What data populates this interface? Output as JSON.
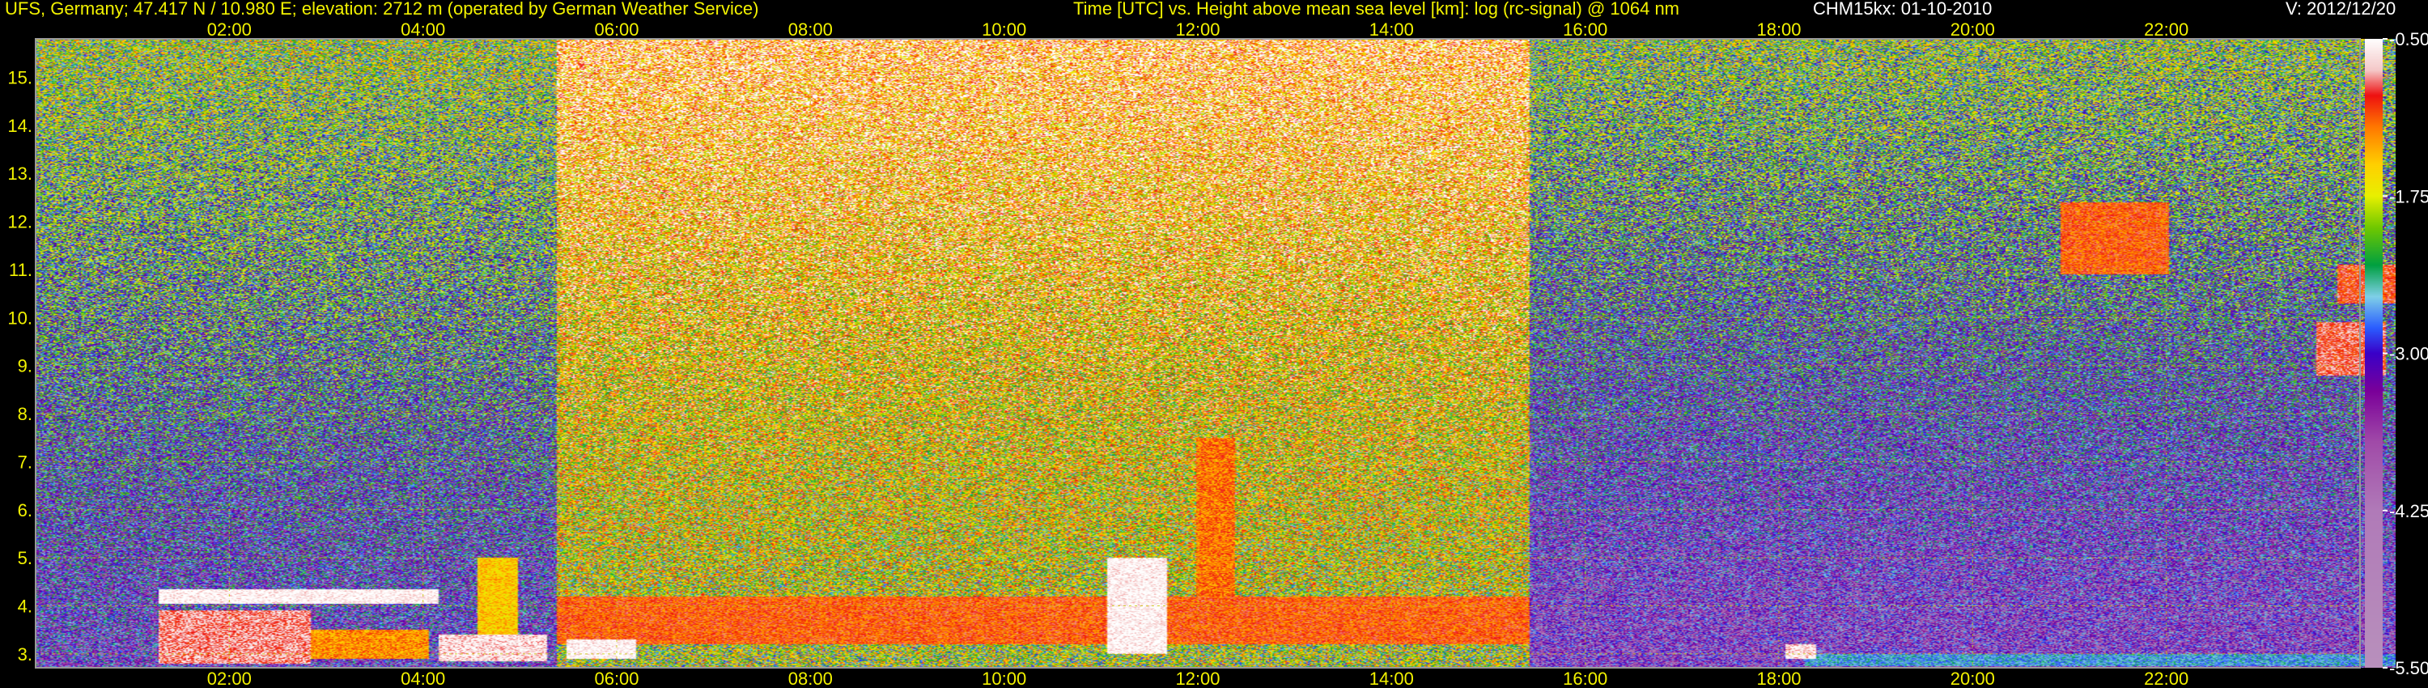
{
  "header": {
    "station": "UFS, Germany; 47.417 N / 10.980 E; elevation: 2712 m  (operated by German Weather Service)",
    "plot_title": "Time [UTC] vs. Height above mean sea level [km]: log (rc-signal) @ 1064 nm",
    "instrument_date": "CHM15kx: 01-10-2010",
    "version": "V: 2012/12/20"
  },
  "colors": {
    "text_yellow": "#f2f200",
    "text_white": "#ffffff",
    "grid": "#c8c800",
    "background": "#000000"
  },
  "chart_data": {
    "type": "heatmap",
    "title": "Time [UTC] vs. Height above mean sea level [km]: log (rc-signal) @ 1064 nm",
    "xlabel": "Time [UTC]",
    "ylabel": "Height above mean sea level [km]",
    "x_unit": "hours UTC",
    "xlim": [
      0.0,
      24.0
    ],
    "ylim": [
      2.712,
      15.8
    ],
    "x_ticks": [
      2,
      4,
      6,
      8,
      10,
      12,
      14,
      16,
      18,
      20,
      22
    ],
    "x_tick_labels": [
      "02:00",
      "04:00",
      "06:00",
      "08:00",
      "10:00",
      "12:00",
      "14:00",
      "16:00",
      "18:00",
      "20:00",
      "22:00"
    ],
    "y_ticks": [
      3,
      4,
      5,
      6,
      7,
      8,
      9,
      10,
      11,
      12,
      13,
      14,
      15
    ],
    "y_tick_labels": [
      "3.",
      "4.",
      "5.",
      "6.",
      "7.",
      "8.",
      "9.",
      "10.",
      "11.",
      "12.",
      "13.",
      "14.",
      "15."
    ],
    "grid": true,
    "colorbar": {
      "position": "right",
      "range": [
        -5.5,
        -0.5
      ],
      "tick_values": [
        -0.5,
        -1.75,
        -3.0,
        -4.25,
        -5.5
      ],
      "tick_labels": [
        "-0.50",
        "-1.75",
        "-3.00",
        "-4.25",
        "-5.50"
      ],
      "stops": [
        {
          "value": -0.5,
          "color": "#ffffff"
        },
        {
          "value": -0.75,
          "color": "#f4c8c8"
        },
        {
          "value": -0.95,
          "color": "#ee1010"
        },
        {
          "value": -1.2,
          "color": "#ff7800"
        },
        {
          "value": -1.5,
          "color": "#ffd000"
        },
        {
          "value": -1.75,
          "color": "#e8f000"
        },
        {
          "value": -2.0,
          "color": "#70c800"
        },
        {
          "value": -2.3,
          "color": "#00a040"
        },
        {
          "value": -2.55,
          "color": "#7fd0e8"
        },
        {
          "value": -2.8,
          "color": "#2a5cff"
        },
        {
          "value": -3.0,
          "color": "#3a00c8"
        },
        {
          "value": -3.3,
          "color": "#7a0099"
        },
        {
          "value": -3.7,
          "color": "#a04aa8"
        },
        {
          "value": -4.25,
          "color": "#b07ab8"
        },
        {
          "value": -5.5,
          "color": "#b890bc"
        }
      ]
    },
    "regimes": [
      {
        "t_start": 0.0,
        "t_end": 5.3,
        "background_upper": -2.0,
        "background_lower": -3.2
      },
      {
        "t_start": 5.3,
        "t_end": 15.2,
        "background_upper": -0.9,
        "background_lower": -2.0
      },
      {
        "t_start": 15.2,
        "t_end": 24.0,
        "background_upper": -2.1,
        "background_lower": -3.5
      }
    ],
    "features": [
      {
        "t_start": 1.25,
        "t_end": 2.8,
        "z_bottom": 2.8,
        "z_top": 3.9,
        "value": -0.8
      },
      {
        "t_start": 1.25,
        "t_end": 4.1,
        "z_bottom": 4.05,
        "z_top": 4.35,
        "value": -0.5
      },
      {
        "t_start": 2.8,
        "t_end": 4.0,
        "z_bottom": 2.9,
        "z_top": 3.5,
        "value": -1.3
      },
      {
        "t_start": 4.1,
        "t_end": 5.2,
        "z_bottom": 2.85,
        "z_top": 3.4,
        "value": -0.6
      },
      {
        "t_start": 4.5,
        "t_end": 4.9,
        "z_bottom": 3.4,
        "z_top": 5.0,
        "value": -1.5
      },
      {
        "t_start": 5.4,
        "t_end": 6.1,
        "z_bottom": 2.9,
        "z_top": 3.3,
        "value": -0.5
      },
      {
        "t_start": 5.3,
        "t_end": 15.2,
        "z_bottom": 3.2,
        "z_top": 4.2,
        "value": -1.1
      },
      {
        "t_start": 10.9,
        "t_end": 11.5,
        "z_bottom": 3.0,
        "z_top": 5.0,
        "value": -0.5
      },
      {
        "t_start": 11.8,
        "t_end": 12.2,
        "z_bottom": 3.6,
        "z_top": 7.5,
        "value": -1.2
      },
      {
        "t_start": 17.8,
        "t_end": 18.1,
        "z_bottom": 2.9,
        "z_top": 3.2,
        "value": -0.6
      },
      {
        "t_start": 18.0,
        "t_end": 24.0,
        "z_bottom": 2.75,
        "z_top": 3.0,
        "value": -2.6
      },
      {
        "t_start": 20.6,
        "t_end": 21.7,
        "z_bottom": 10.9,
        "z_top": 12.4,
        "value": -1.1
      },
      {
        "t_start": 23.2,
        "t_end": 23.9,
        "z_bottom": 8.8,
        "z_top": 9.9,
        "value": -0.9
      },
      {
        "t_start": 23.4,
        "t_end": 24.0,
        "z_bottom": 10.3,
        "z_top": 11.1,
        "value": -1.0
      }
    ]
  }
}
